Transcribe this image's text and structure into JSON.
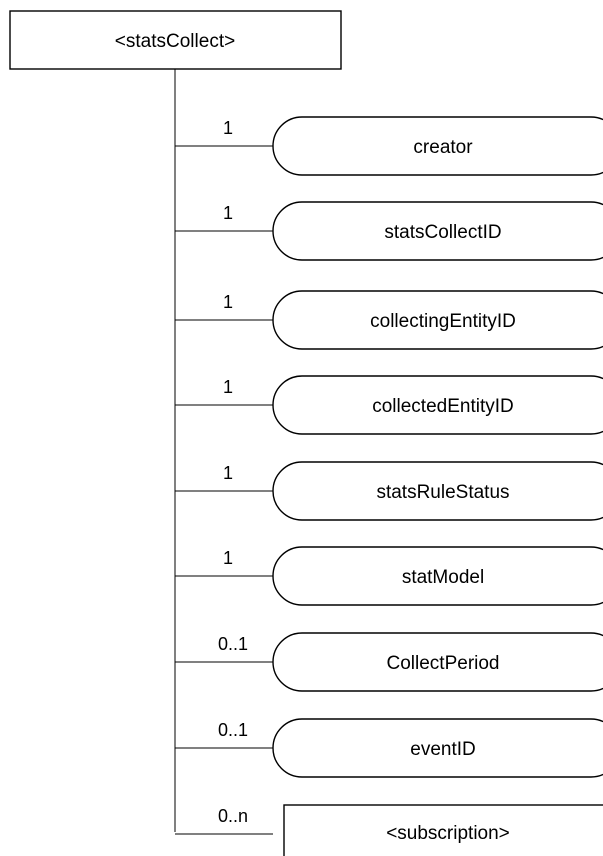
{
  "root": {
    "label": "<statsCollect>"
  },
  "children": [
    {
      "label": "creator",
      "cardinality": "1",
      "shape": "attribute"
    },
    {
      "label": "statsCollectID",
      "cardinality": "1",
      "shape": "attribute"
    },
    {
      "label": "collectingEntityID",
      "cardinality": "1",
      "shape": "attribute"
    },
    {
      "label": "collectedEntityID",
      "cardinality": "1",
      "shape": "attribute"
    },
    {
      "label": "statsRuleStatus",
      "cardinality": "1",
      "shape": "attribute"
    },
    {
      "label": "statModel",
      "cardinality": "1",
      "shape": "attribute"
    },
    {
      "label": "CollectPeriod",
      "cardinality": "0..1",
      "shape": "attribute"
    },
    {
      "label": "eventID",
      "cardinality": "0..1",
      "shape": "attribute"
    },
    {
      "label": "<subscription>",
      "cardinality": "0..n",
      "shape": "resource"
    }
  ]
}
